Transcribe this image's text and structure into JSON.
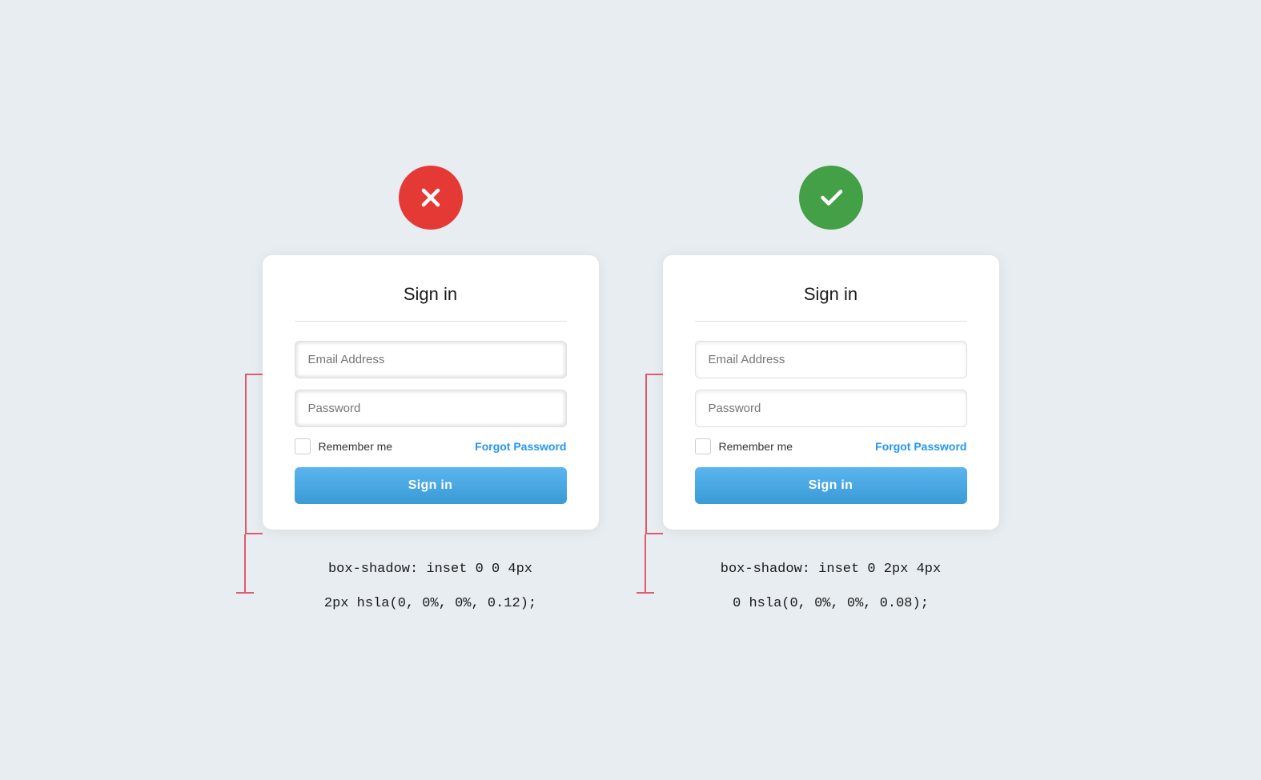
{
  "page": {
    "background": "#e8edf2"
  },
  "bad_panel": {
    "badge_type": "bad",
    "card_title": "Sign in",
    "email_placeholder": "Email Address",
    "password_placeholder": "Password",
    "remember_label": "Remember me",
    "forgot_label": "Forgot Password",
    "signin_label": "Sign in",
    "code_line1": "box-shadow: inset 0 0 4px",
    "code_line2": "2px hsla(0, 0%, 0%, 0.12);"
  },
  "good_panel": {
    "badge_type": "good",
    "card_title": "Sign in",
    "email_placeholder": "Email Address",
    "password_placeholder": "Password",
    "remember_label": "Remember me",
    "forgot_label": "Forgot Password",
    "signin_label": "Sign in",
    "code_line1": "box-shadow: inset 0 2px 4px",
    "code_line2": "0 hsla(0, 0%, 0%, 0.08);"
  }
}
